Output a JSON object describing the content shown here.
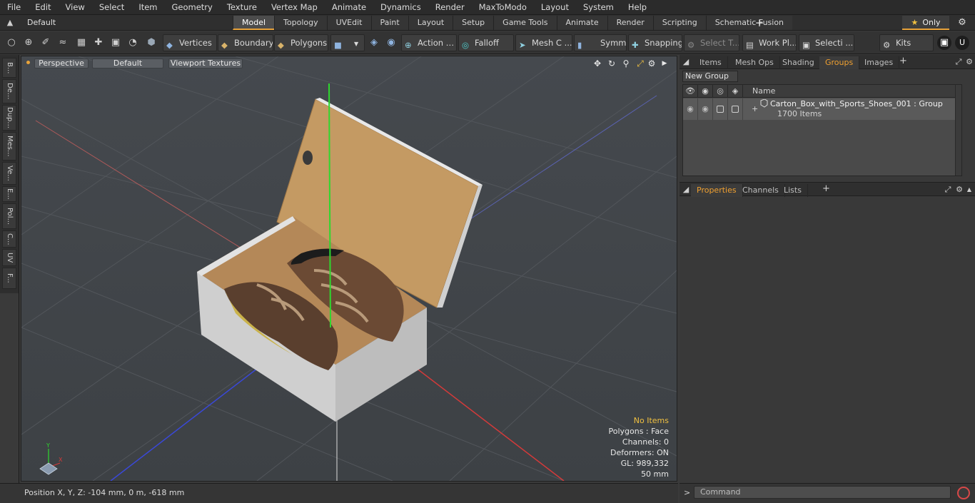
{
  "menu": [
    "File",
    "Edit",
    "View",
    "Select",
    "Item",
    "Geometry",
    "Texture",
    "Vertex Map",
    "Animate",
    "Dynamics",
    "Render",
    "MaxToModo",
    "Layout",
    "System",
    "Help"
  ],
  "layout_select": "Default Layouts",
  "mode_tabs": [
    {
      "label": "Model",
      "active": true
    },
    {
      "label": "Topology",
      "active": false
    },
    {
      "label": "UVEdit",
      "active": false
    },
    {
      "label": "Paint",
      "active": false
    },
    {
      "label": "Layout",
      "active": false
    },
    {
      "label": "Setup",
      "active": false
    },
    {
      "label": "Game Tools",
      "active": false
    },
    {
      "label": "Animate",
      "active": false
    },
    {
      "label": "Render",
      "active": false
    },
    {
      "label": "Scripting",
      "active": false
    },
    {
      "label": "Schematic Fusion",
      "active": false
    }
  ],
  "only_label": "Only",
  "toolbar": {
    "vertices": "Vertices",
    "boundary": "Boundary",
    "polygons": "Polygons",
    "action": "Action",
    "falloff": "Falloff",
    "mesh": "Mesh C ...",
    "symm": "Symm ...",
    "snapping": "Snapping",
    "select_t": "Select T...",
    "work_pl": "Work Pl...",
    "selecti": "Selecti ...",
    "kits": "Kits"
  },
  "left_tabs": [
    "B...",
    "De...",
    "Dup...",
    "Mes...",
    "Ve...",
    "E...",
    "Pol...",
    "C...",
    "UV",
    "F..."
  ],
  "viewport": {
    "perspective": "Perspective",
    "default": "Default",
    "textures": "Viewport Textures",
    "stats": [
      "No Items",
      "Polygons : Face",
      "Channels: 0",
      "Deformers: ON",
      "GL: 989,332",
      "50 mm"
    ],
    "axis_x": "X",
    "axis_y": "Y"
  },
  "status_text": "Position X, Y, Z:   -104 mm, 0 m, -618 mm",
  "right_tabs": [
    {
      "label": "Items",
      "active": false
    },
    {
      "label": "Mesh Ops",
      "active": false
    },
    {
      "label": "Shading",
      "active": false
    },
    {
      "label": "Groups",
      "active": true
    },
    {
      "label": "Images",
      "active": false
    }
  ],
  "groups": {
    "new_group": "New Group",
    "name_header": "Name",
    "row_title": "Carton_Box_with_Sports_Shoes_001 : Group",
    "row_sub": "1700 Items"
  },
  "prop_tabs": [
    {
      "label": "Properties",
      "active": true
    },
    {
      "label": "Channels",
      "active": false
    },
    {
      "label": "Lists",
      "active": false
    }
  ],
  "command_placeholder": "Command",
  "colors": {
    "accent": "#e8a33a",
    "viewport_bg": "#4a4e53",
    "box": "#d8d8d8",
    "cardboard": "#c49a63"
  }
}
